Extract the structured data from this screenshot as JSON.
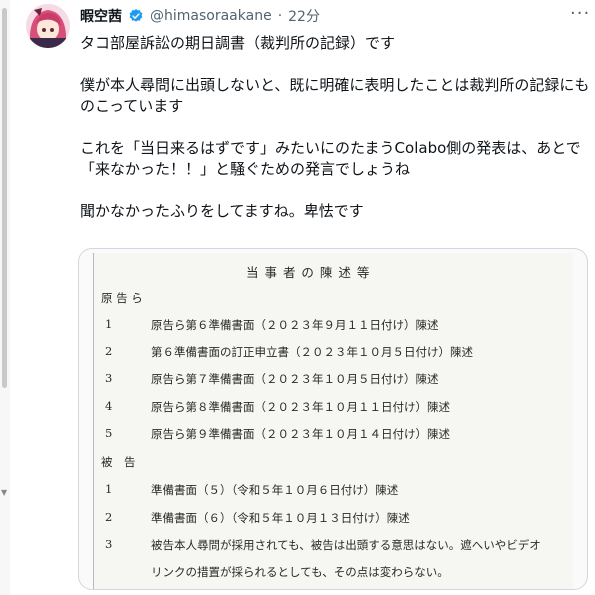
{
  "post": {
    "display_name": "暇空茜",
    "handle": "@himasoraakane",
    "separator": "·",
    "time": "22分",
    "more": "···",
    "text": [
      "タコ部屋訴訟の期日調書（裁判所の記録）です",
      "",
      "僕が本人尋問に出頭しないと、既に明確に表明したことは裁判所の記録にものこっています",
      "",
      "これを「当日来るはずです」みたいにのたまうColabo側の発表は、あとで「来なかった！！」と騒ぐための発言でしょうね",
      "",
      "聞かなかったふりをしてますね。卑怯です"
    ]
  },
  "document": {
    "title": "当 事 者 の 陳 述 等",
    "plaintiff_heading": "原 告 ら",
    "plaintiff_items": [
      {
        "num": "1",
        "text": "原告ら第６準備書面（２０２３年９月１１日付け）陳述"
      },
      {
        "num": "2",
        "text": "第６準備書面の訂正申立書（２０２３年１０月５日付け）陳述"
      },
      {
        "num": "3",
        "text": "原告ら第７準備書面（２０２３年１０月５日付け）陳述"
      },
      {
        "num": "4",
        "text": "原告ら第８準備書面（２０２３年１０月１１日付け）陳述"
      },
      {
        "num": "5",
        "text": "原告ら第９準備書面（２０２３年１０月１４日付け）陳述"
      }
    ],
    "defendant_heading": "被　告",
    "defendant_items": [
      {
        "num": "1",
        "text": "準備書面（５）（令和５年１０月６日付け）陳述"
      },
      {
        "num": "2",
        "text": "準備書面（６）（令和５年１０月１３日付け）陳述"
      },
      {
        "num": "3",
        "text": "被告本人尋問が採用されても、被告は出頭する意思はない。遮へいやビデオ"
      }
    ],
    "continuation": "リンクの措置が採られるとしても、その点は変わらない。"
  },
  "colors": {
    "text": "#0f1419",
    "muted": "#536471",
    "verified": "#1d9bf0",
    "border": "#cfd9de"
  }
}
